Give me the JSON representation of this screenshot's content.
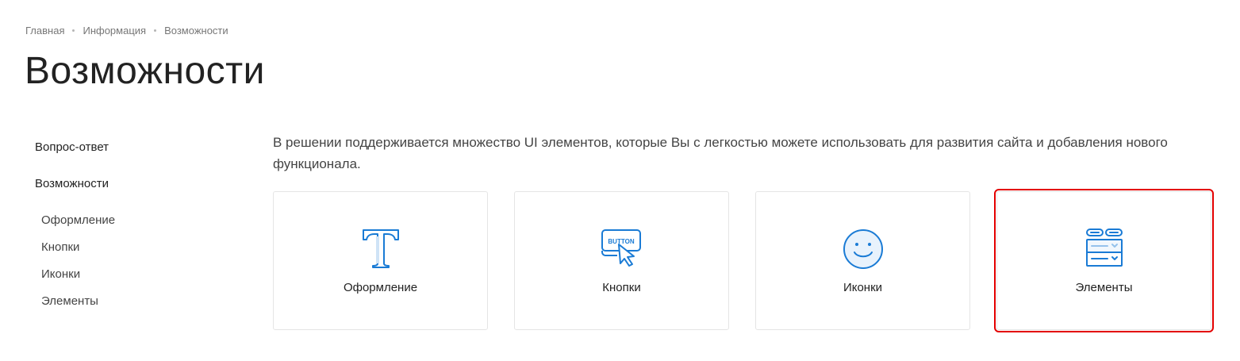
{
  "breadcrumb": {
    "items": [
      "Главная",
      "Информация",
      "Возможности"
    ]
  },
  "page": {
    "title": "Возможности",
    "intro": "В решении поддерживается множество UI элементов, которые Вы с легкостью можете использовать для развития сайта и добавления нового функционала."
  },
  "sidebar": {
    "items": [
      {
        "label": "Вопрос-ответ"
      },
      {
        "label": "Возможности"
      }
    ],
    "subitems": [
      {
        "label": "Оформление"
      },
      {
        "label": "Кнопки"
      },
      {
        "label": "Иконки"
      },
      {
        "label": "Элементы"
      }
    ]
  },
  "cards": [
    {
      "label": "Оформление",
      "icon": "typography-icon"
    },
    {
      "label": "Кнопки",
      "icon": "button-cursor-icon"
    },
    {
      "label": "Иконки",
      "icon": "smiley-icon"
    },
    {
      "label": "Элементы",
      "icon": "elements-icon"
    }
  ],
  "colors": {
    "accent": "#1a7bd5",
    "highlight": "#e30000"
  }
}
